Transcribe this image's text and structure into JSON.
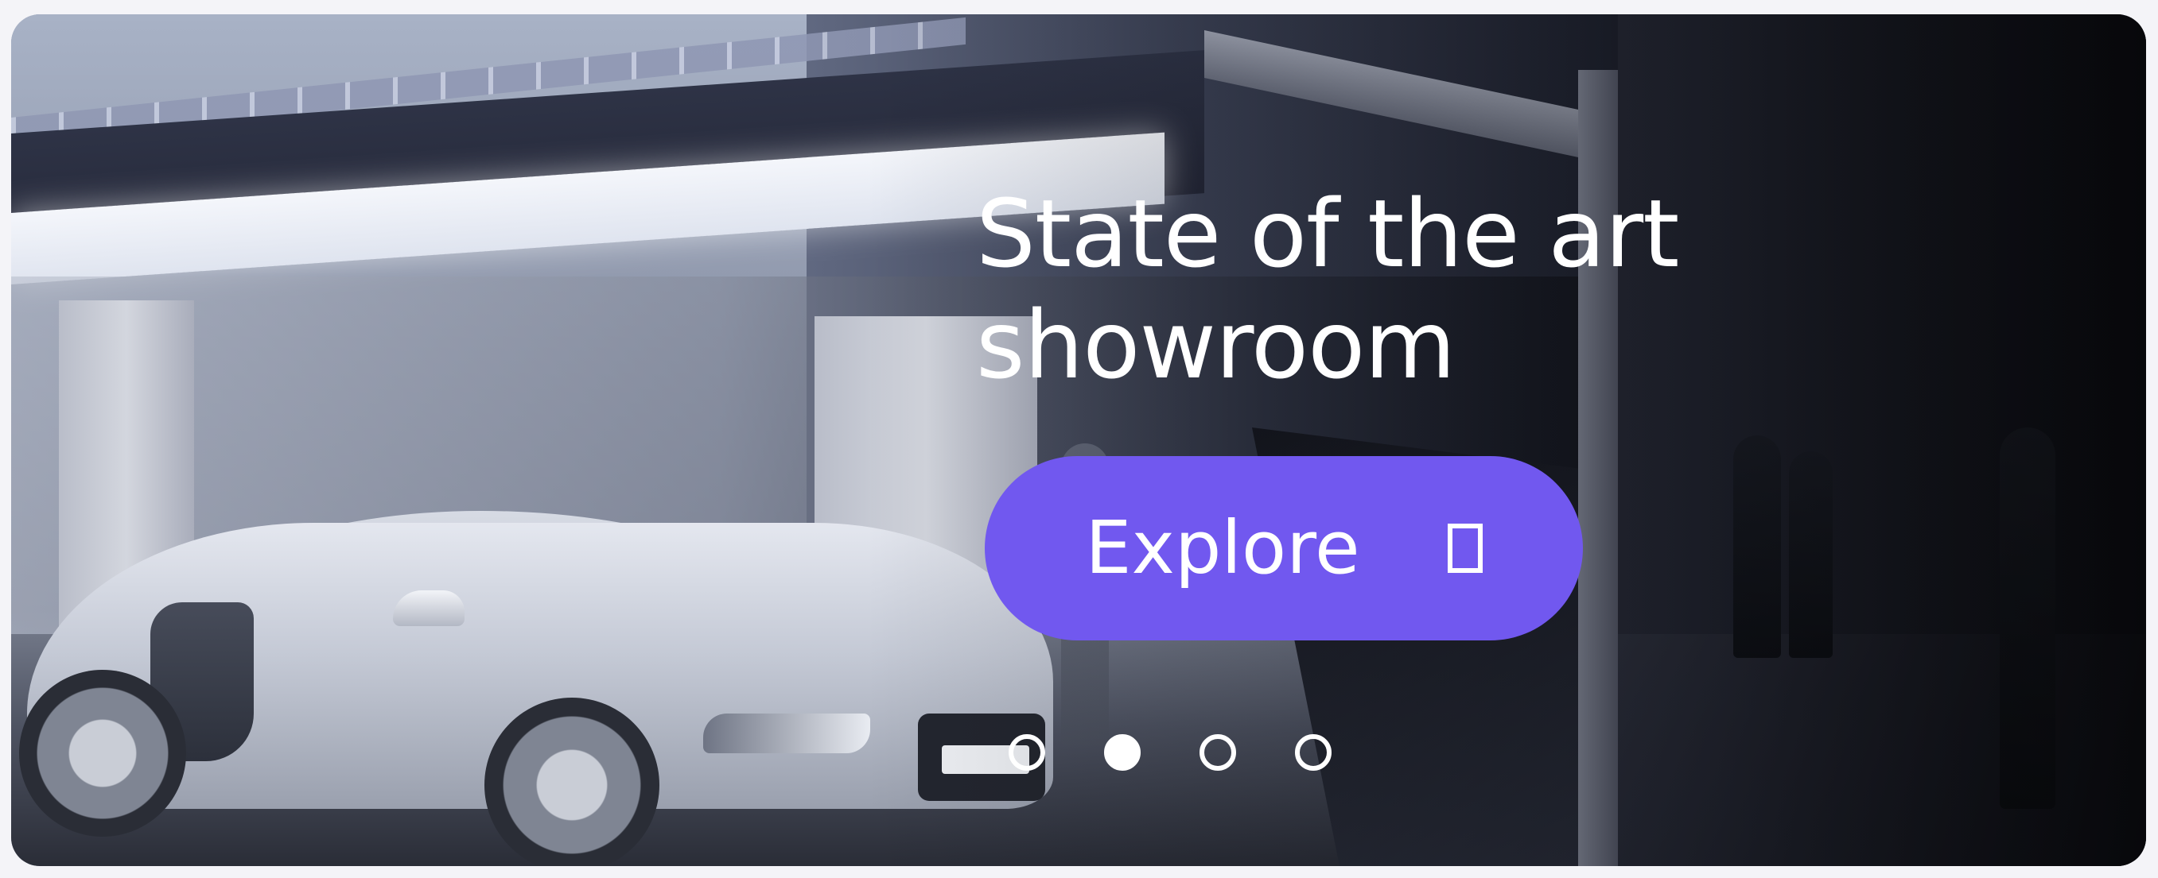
{
  "hero": {
    "headline": "State of the art showroom",
    "cta": {
      "label": "Explore",
      "icon": "arrow-right-icon",
      "background": "#7158ef"
    },
    "background_image": "sports-car-showroom-photo"
  },
  "carousel": {
    "slide_count": 4,
    "active_index": 1
  },
  "colors": {
    "page_background": "#f4f4f8",
    "text": "#ffffff",
    "accent": "#7158ef"
  }
}
